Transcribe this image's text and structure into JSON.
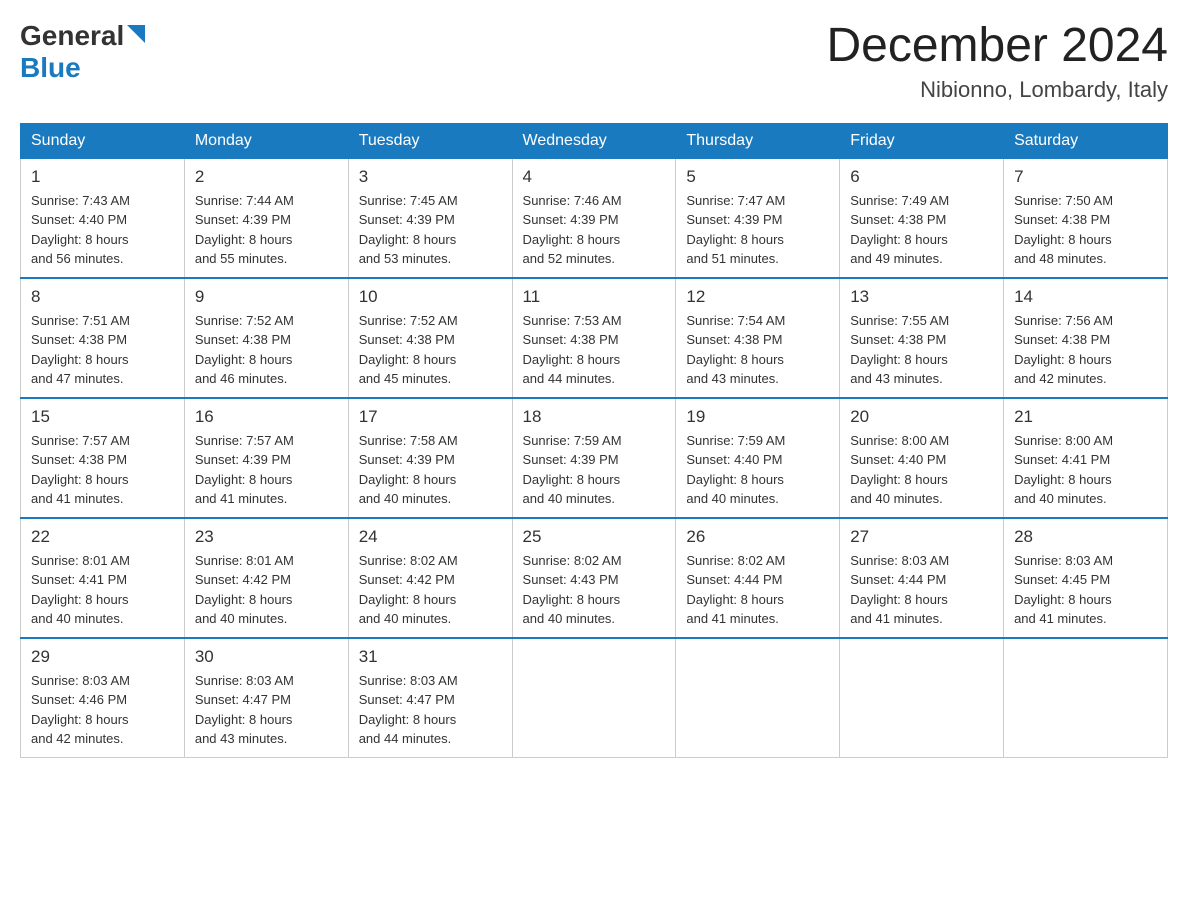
{
  "logo": {
    "general": "General",
    "blue": "Blue"
  },
  "title": "December 2024",
  "location": "Nibionno, Lombardy, Italy",
  "days_of_week": [
    "Sunday",
    "Monday",
    "Tuesday",
    "Wednesday",
    "Thursday",
    "Friday",
    "Saturday"
  ],
  "weeks": [
    [
      {
        "day": "1",
        "sunrise": "7:43 AM",
        "sunset": "4:40 PM",
        "daylight": "8 hours and 56 minutes."
      },
      {
        "day": "2",
        "sunrise": "7:44 AM",
        "sunset": "4:39 PM",
        "daylight": "8 hours and 55 minutes."
      },
      {
        "day": "3",
        "sunrise": "7:45 AM",
        "sunset": "4:39 PM",
        "daylight": "8 hours and 53 minutes."
      },
      {
        "day": "4",
        "sunrise": "7:46 AM",
        "sunset": "4:39 PM",
        "daylight": "8 hours and 52 minutes."
      },
      {
        "day": "5",
        "sunrise": "7:47 AM",
        "sunset": "4:39 PM",
        "daylight": "8 hours and 51 minutes."
      },
      {
        "day": "6",
        "sunrise": "7:49 AM",
        "sunset": "4:38 PM",
        "daylight": "8 hours and 49 minutes."
      },
      {
        "day": "7",
        "sunrise": "7:50 AM",
        "sunset": "4:38 PM",
        "daylight": "8 hours and 48 minutes."
      }
    ],
    [
      {
        "day": "8",
        "sunrise": "7:51 AM",
        "sunset": "4:38 PM",
        "daylight": "8 hours and 47 minutes."
      },
      {
        "day": "9",
        "sunrise": "7:52 AM",
        "sunset": "4:38 PM",
        "daylight": "8 hours and 46 minutes."
      },
      {
        "day": "10",
        "sunrise": "7:52 AM",
        "sunset": "4:38 PM",
        "daylight": "8 hours and 45 minutes."
      },
      {
        "day": "11",
        "sunrise": "7:53 AM",
        "sunset": "4:38 PM",
        "daylight": "8 hours and 44 minutes."
      },
      {
        "day": "12",
        "sunrise": "7:54 AM",
        "sunset": "4:38 PM",
        "daylight": "8 hours and 43 minutes."
      },
      {
        "day": "13",
        "sunrise": "7:55 AM",
        "sunset": "4:38 PM",
        "daylight": "8 hours and 43 minutes."
      },
      {
        "day": "14",
        "sunrise": "7:56 AM",
        "sunset": "4:38 PM",
        "daylight": "8 hours and 42 minutes."
      }
    ],
    [
      {
        "day": "15",
        "sunrise": "7:57 AM",
        "sunset": "4:38 PM",
        "daylight": "8 hours and 41 minutes."
      },
      {
        "day": "16",
        "sunrise": "7:57 AM",
        "sunset": "4:39 PM",
        "daylight": "8 hours and 41 minutes."
      },
      {
        "day": "17",
        "sunrise": "7:58 AM",
        "sunset": "4:39 PM",
        "daylight": "8 hours and 40 minutes."
      },
      {
        "day": "18",
        "sunrise": "7:59 AM",
        "sunset": "4:39 PM",
        "daylight": "8 hours and 40 minutes."
      },
      {
        "day": "19",
        "sunrise": "7:59 AM",
        "sunset": "4:40 PM",
        "daylight": "8 hours and 40 minutes."
      },
      {
        "day": "20",
        "sunrise": "8:00 AM",
        "sunset": "4:40 PM",
        "daylight": "8 hours and 40 minutes."
      },
      {
        "day": "21",
        "sunrise": "8:00 AM",
        "sunset": "4:41 PM",
        "daylight": "8 hours and 40 minutes."
      }
    ],
    [
      {
        "day": "22",
        "sunrise": "8:01 AM",
        "sunset": "4:41 PM",
        "daylight": "8 hours and 40 minutes."
      },
      {
        "day": "23",
        "sunrise": "8:01 AM",
        "sunset": "4:42 PM",
        "daylight": "8 hours and 40 minutes."
      },
      {
        "day": "24",
        "sunrise": "8:02 AM",
        "sunset": "4:42 PM",
        "daylight": "8 hours and 40 minutes."
      },
      {
        "day": "25",
        "sunrise": "8:02 AM",
        "sunset": "4:43 PM",
        "daylight": "8 hours and 40 minutes."
      },
      {
        "day": "26",
        "sunrise": "8:02 AM",
        "sunset": "4:44 PM",
        "daylight": "8 hours and 41 minutes."
      },
      {
        "day": "27",
        "sunrise": "8:03 AM",
        "sunset": "4:44 PM",
        "daylight": "8 hours and 41 minutes."
      },
      {
        "day": "28",
        "sunrise": "8:03 AM",
        "sunset": "4:45 PM",
        "daylight": "8 hours and 41 minutes."
      }
    ],
    [
      {
        "day": "29",
        "sunrise": "8:03 AM",
        "sunset": "4:46 PM",
        "daylight": "8 hours and 42 minutes."
      },
      {
        "day": "30",
        "sunrise": "8:03 AM",
        "sunset": "4:47 PM",
        "daylight": "8 hours and 43 minutes."
      },
      {
        "day": "31",
        "sunrise": "8:03 AM",
        "sunset": "4:47 PM",
        "daylight": "8 hours and 44 minutes."
      },
      null,
      null,
      null,
      null
    ]
  ],
  "labels": {
    "sunrise": "Sunrise:",
    "sunset": "Sunset:",
    "daylight": "Daylight:"
  }
}
